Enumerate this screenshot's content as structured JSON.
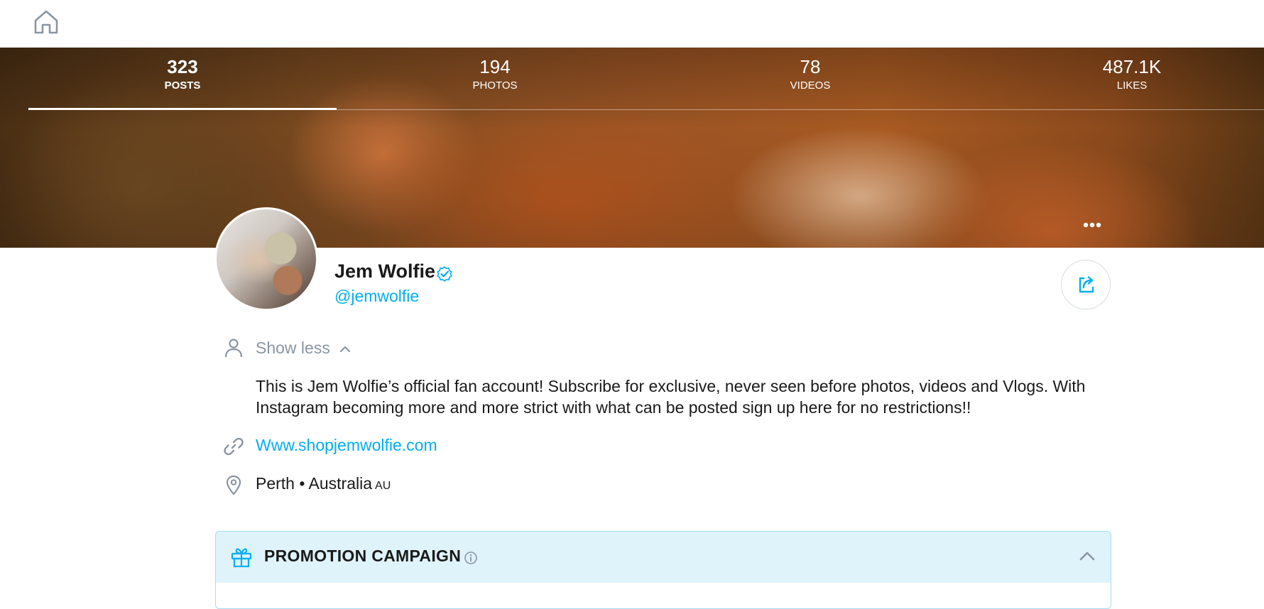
{
  "stats": [
    {
      "value": "323",
      "label": "POSTS"
    },
    {
      "value": "194",
      "label": "PHOTOS"
    },
    {
      "value": "78",
      "label": "VIDEOS"
    },
    {
      "value": "487.1K",
      "label": "LIKES"
    }
  ],
  "profile": {
    "name": "Jem Wolfie",
    "handle": "@jemwolfie"
  },
  "about": {
    "toggle_label": "Show less",
    "bio": "This is Jem Wolfie’s official fan account! Subscribe for exclusive, never seen before photos, videos and Vlogs. With Instagram becoming more and more strict with what can be posted sign up here for no restrictions!!",
    "website": "Www.shopjemwolfie.com",
    "location": "Perth • Australia",
    "country_code": "AU"
  },
  "promo": {
    "title": "PROMOTION CAMPAIGN"
  },
  "colors": {
    "accent": "#00aff0",
    "muted": "#8a96a3",
    "promo_bg": "#dff3fb"
  }
}
